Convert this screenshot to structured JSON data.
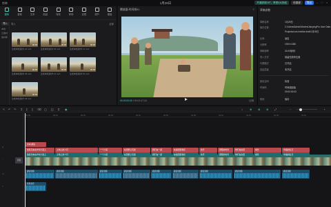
{
  "window": {
    "title": "1月28日",
    "menu_label": "剪映",
    "vip_label": "开通剪映VIP，享受5大特权",
    "shortcut_label": "快捷键",
    "export_label": "导出"
  },
  "media": {
    "tools": [
      {
        "label": "媒体",
        "icon": "media-icon"
      },
      {
        "label": "音频",
        "icon": "audio-icon"
      },
      {
        "label": "文本",
        "icon": "text-icon"
      },
      {
        "label": "贴纸",
        "icon": "sticker-icon"
      },
      {
        "label": "特效",
        "icon": "effects-icon"
      },
      {
        "label": "转场",
        "icon": "transition-icon"
      },
      {
        "label": "滤镜",
        "icon": "filter-icon"
      },
      {
        "label": "调节",
        "icon": "adjust-icon"
      },
      {
        "label": "模板",
        "icon": "template-icon"
      }
    ],
    "import_label": "导入",
    "side_items": [
      "本地",
      "云素材",
      "素材库"
    ],
    "section_label": "导入",
    "filter_label": "全部",
    "thumbs": [
      {
        "caption": "生成本地素材1 20.mp4",
        "duration": "00:05"
      },
      {
        "caption": "生成本地素材2 03.mp4",
        "duration": "00:05"
      },
      {
        "caption": "生成本地素材3 12.mp4",
        "duration": "00:05"
      },
      {
        "caption": "生成本地素材4 08.mp4",
        "duration": "00:05"
      },
      {
        "caption": "生成本地素材5 16.mp4",
        "duration": "00:05"
      },
      {
        "caption": "生成本地素材6 02.mp4",
        "duration": "00:05"
      },
      {
        "caption": "生成本地素材7 09.mp4",
        "duration": "00:05"
      }
    ]
  },
  "player": {
    "title": "播放器-时间线01",
    "time_current": "00:00:00:00",
    "time_total": "00:02:47:18",
    "ratio_label": "比例",
    "menu_icon": "more-icon"
  },
  "props": {
    "header": "草稿参数",
    "rows": [
      {
        "k": "草稿名称",
        "v": "1月28日"
      },
      {
        "k": "保存位置",
        "v": "C:/Users/Admin/Movies/JianyingPro User Data"
      },
      {
        "k": "",
        "v": "Projects/com.lveditor.draft/1月28日"
      },
      {
        "k": "比例",
        "v": "适应"
      },
      {
        "k": "分辨率",
        "v": "1920×1080"
      },
      {
        "k": "草稿帧率",
        "v": "30.00帧/秒"
      },
      {
        "k": "导入方式",
        "v": "保留在原有位置"
      },
      {
        "k": "代理模式",
        "v": "已开启"
      },
      {
        "k": "自由层级",
        "v": "未开启"
      },
      {
        "k": "颜色空间",
        "v": "标准"
      },
      {
        "k": "",
        "v": ""
      },
      {
        "k": "时间码",
        "v": "时间线起始"
      },
      {
        "k": "",
        "v": "00:00:00:00"
      },
      {
        "k": "修改",
        "v": "保存"
      }
    ]
  },
  "timeline": {
    "ruler": [
      "00:00",
      "00:10",
      "00:20",
      "00:30",
      "00:40",
      "00:50",
      "01:00",
      "01:10",
      "01:20",
      "01:30",
      "01:40"
    ],
    "cover_label": "封面",
    "text_track_top": [
      {
        "label": "文本 朗读"
      },
      {
        "label": "坐着马车在乡村小道上"
      },
      {
        "label": "土地上的人们"
      },
      {
        "label": "一个小孩"
      },
      {
        "label": "在田野上玩耍"
      },
      {
        "label": "我们在一起"
      },
      {
        "label": "在稻田里收获"
      },
      {
        "label": "欢乐"
      },
      {
        "label": "团聚的时光"
      },
      {
        "label": "他们在这里"
      },
      {
        "label": "成长"
      },
      {
        "label": "幸福的生活"
      }
    ],
    "text_track_bottom": [
      {
        "label": "贴合 朗读"
      },
      {
        "label": "坐着马车在乡村小道上"
      },
      {
        "label": "土地上的人们"
      },
      {
        "label": "一个小孩"
      },
      {
        "label": "在田野上玩耍"
      },
      {
        "label": "我们在一起"
      },
      {
        "label": "在稻田里收获"
      },
      {
        "label": "欢乐"
      },
      {
        "label": "团聚的时光"
      },
      {
        "label": "他们在这里"
      },
      {
        "label": "成长"
      },
      {
        "label": "幸福的生活"
      }
    ],
    "audio_track": [
      {
        "label": "朗读音频"
      },
      {
        "label": "朗读音频"
      },
      {
        "label": "朗读音频"
      },
      {
        "label": "朗读音频"
      },
      {
        "label": "朗读音频"
      },
      {
        "label": "朗读音频"
      },
      {
        "label": "朗读音频"
      },
      {
        "label": "朗读音频"
      },
      {
        "label": "朗读音频"
      }
    ],
    "music_clip": {
      "label": "背景音乐"
    }
  },
  "colors": {
    "accent": "#4dd1c1",
    "text_clip": "#b84a4f",
    "audio_clip": "#1e4e6a",
    "export": "#2b73e6"
  }
}
